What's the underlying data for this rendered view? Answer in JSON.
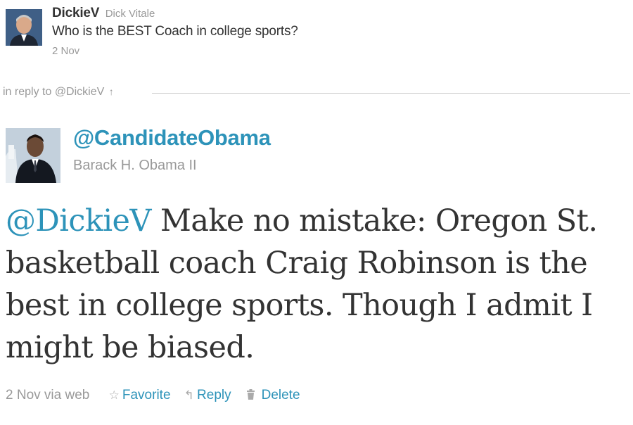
{
  "parent_tweet": {
    "screen_name": "DickieV",
    "full_name": "Dick Vitale",
    "text": "Who is the BEST Coach in college sports?",
    "date": "2 Nov",
    "avatar_icon": "user-avatar-photo"
  },
  "reply_context": {
    "label": "in reply to @DickieV",
    "arrow": "↑"
  },
  "tweet": {
    "screen_name": "@CandidateObama",
    "full_name": "Barack H. Obama II",
    "mention": "@DickieV",
    "text": " Make no mistake: Oregon St. basketball coach Craig Robinson is the best in college sports. Though I admit I might be biased.",
    "avatar_icon": "user-avatar-photo"
  },
  "meta": {
    "date_via": "2 Nov via web",
    "favorite_label": "Favorite",
    "favorite_icon": "☆",
    "reply_label": "Reply",
    "reply_icon": "↰",
    "delete_label": "Delete",
    "delete_icon": "🗑"
  },
  "colors": {
    "link": "#2d93b9",
    "muted": "#999999",
    "text": "#333333"
  }
}
